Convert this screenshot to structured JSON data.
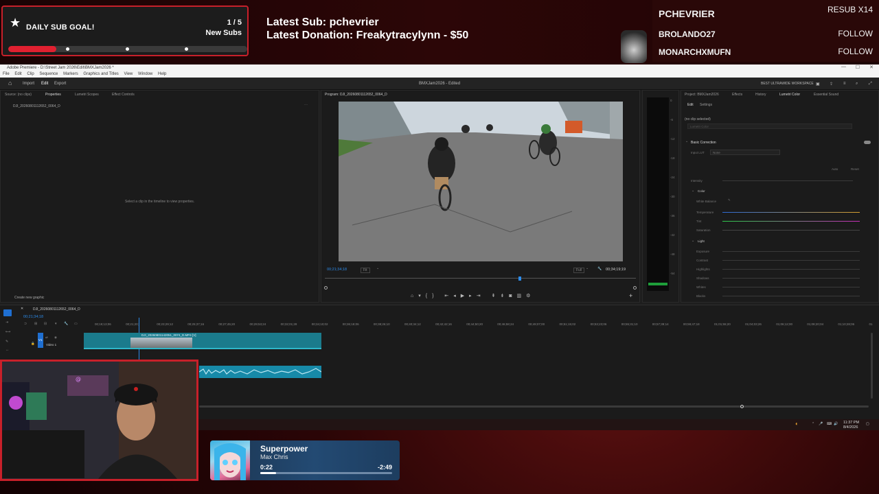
{
  "overlay": {
    "goal": {
      "title": "DAILY SUB GOAL!",
      "count": "1 / 5",
      "subtitle": "New Subs",
      "progress": 0.2
    },
    "latest_sub": "Latest Sub: pchevrier",
    "latest_donation": "Latest Donation: Freakytracylynn  - $50",
    "feed": [
      {
        "name": "PCHEVRIER",
        "tag": "RESUB X14"
      },
      {
        "name": "BROLANDO27",
        "tag": "FOLLOW"
      },
      {
        "name": "MONARCHXMUFN",
        "tag": "FOLLOW"
      }
    ]
  },
  "premiere": {
    "window_title": "Adobe Premiere - D:\\Street Jam 2026\\Edit\\BMXJam2026 *",
    "menu": [
      "File",
      "Edit",
      "Clip",
      "Sequence",
      "Markers",
      "Graphics and Titles",
      "View",
      "Window",
      "Help"
    ],
    "app_tabs": [
      "Import",
      "Edit",
      "Export"
    ],
    "project_title": "BMXJam2026 - Edited",
    "workspace": "BEST ULTRAWIDE WORKSPACE",
    "left_tabs": [
      "Source: (no clips)",
      "Properties",
      "Lumetri Scopes",
      "Effect Controls"
    ],
    "left_clip": "DJI_20260801112652_0064_D",
    "properties_hint": "Select a clip in the timeline to view properties.",
    "create_graphic": "Create new graphic",
    "program_tab": "Program: DJI_20260801112652_0064_D",
    "program_timecode": "00;21;34;18",
    "fit": "Fit",
    "full": "Full",
    "program_duration": "00;34;19;19",
    "right_tabs": [
      "Project: BMXJam2026",
      "Effects",
      "History",
      "Lumetri Color",
      "Essential Sound"
    ],
    "lumetri": {
      "sub_tabs": [
        "Edit",
        "Settings"
      ],
      "no_clip": "(no clip selected)",
      "lumetri_color": "Lumetri Color",
      "basic_correction": "Basic Correction",
      "input_lut_label": "Input LUT",
      "input_lut_value": "None",
      "auto": "Auto",
      "reset": "Reset",
      "intensity": "Intensity",
      "color": "Color",
      "white_balance": "White Balance",
      "temperature": "Temperature",
      "tint": "Tint",
      "saturation": "Saturation",
      "light": "Light",
      "exposure": "Exposure",
      "contrast": "Contrast",
      "highlights": "Highlights",
      "shadows": "Shadows",
      "whites": "Whites",
      "blacks": "Blacks"
    },
    "meter_scale": [
      "0",
      "-6",
      "-12",
      "-18",
      "-24",
      "-30",
      "-36",
      "-42",
      "-48",
      "-54"
    ],
    "timeline": {
      "sequence_tab": "DJI_20260801112652_0064_D",
      "timecode": "00;21;34;18",
      "ruler": [
        "00;19;13;06",
        "00;21;20;",
        "00;23;29;12",
        "00;25;37;16",
        "00;27;45;20",
        "00;29;53;24",
        "00;32;01;28",
        "00;34;10;02",
        "00;36;18;06",
        "00;38;26;10",
        "00;40;34;12",
        "00;42;42;16",
        "00;44;50;20",
        "00;46;58;24",
        "00;49;07;00",
        "00;51;15;02",
        "00;53;23;06",
        "00;55;31;10",
        "00;57;39;14",
        "00;59;47;18",
        "01;01;55;20",
        "01;04;03;26",
        "01;06;12;00",
        "01;08;20;04",
        "01;10;28;06",
        "01"
      ],
      "video_clip": "DJI_20260801142051_0074_D.MP4 [V]",
      "track_label": "Video 1",
      "track_v1": "V1"
    },
    "tray_time": "11:37 PM",
    "tray_date": "8/4/2026"
  },
  "music": {
    "title": "Superpower",
    "artist": "Max Chris",
    "current": "0:22",
    "remaining": "-2:49",
    "progress": 0.12
  },
  "colors": {
    "accent_red": "#c8202a",
    "premiere_blue": "#1b7b8c",
    "music_bg": "#234a73"
  }
}
